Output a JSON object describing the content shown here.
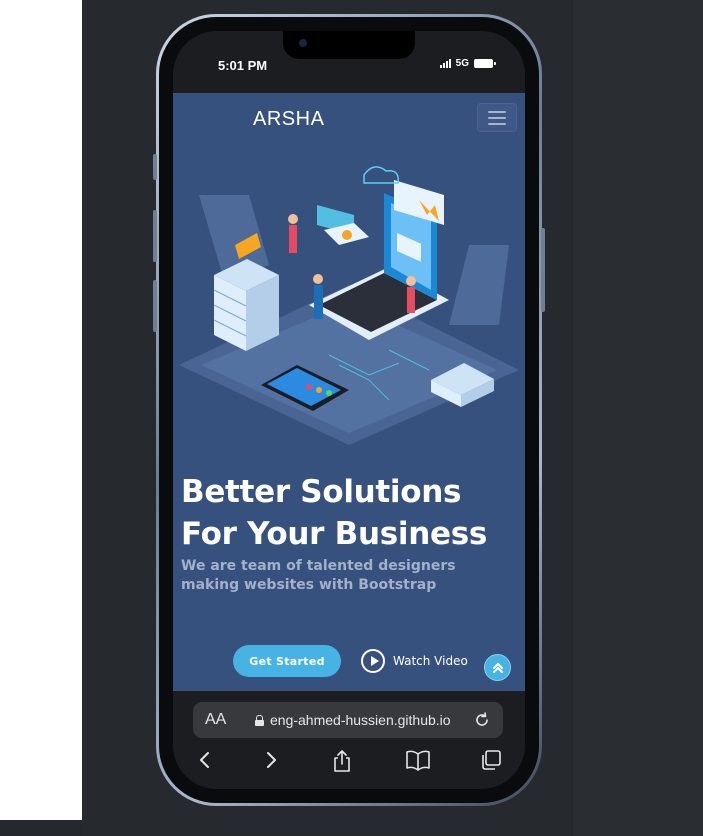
{
  "status_bar": {
    "time": "5:01 PM",
    "network": "5G"
  },
  "navbar": {
    "logo": "ARSHA"
  },
  "hero": {
    "title": "Better Solutions For Your Business",
    "subtitle": "We are team of talented designers making websites with Bootstrap",
    "primary_cta": "Get Started",
    "secondary_cta": "Watch Video"
  },
  "browser": {
    "text_size_label": "AA",
    "url": "eng-ahmed-hussien.github.io"
  },
  "colors": {
    "hero_bg": "#37517e",
    "accent": "#47b2e4",
    "subtitle": "#a3b1c9"
  },
  "icons": [
    "menu-icon",
    "play-icon",
    "chevron-up-icon",
    "lock-icon",
    "reload-icon",
    "back-icon",
    "forward-icon",
    "share-icon",
    "bookmarks-icon",
    "tabs-icon"
  ]
}
